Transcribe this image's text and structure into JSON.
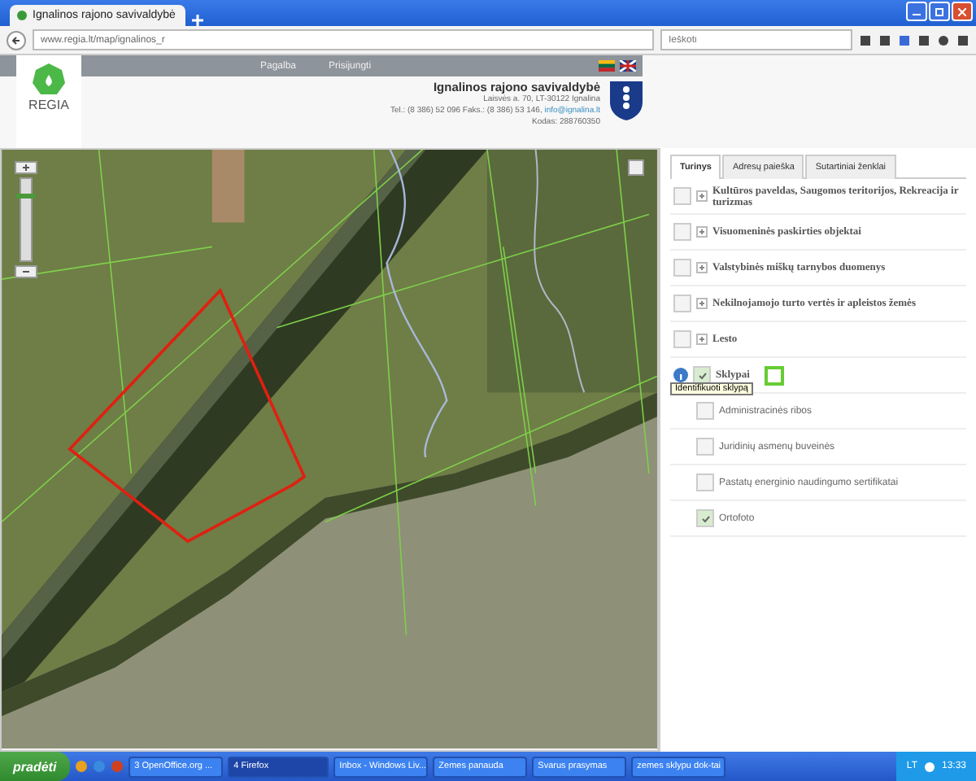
{
  "browser": {
    "tab_title": "Ignalinos rajono savivaldybė",
    "url": "www.regia.lt/map/ignalinos_r",
    "search": {
      "placeholder": "Ieškoti"
    }
  },
  "site": {
    "nav": [
      "Pagalba",
      "Prisijungti"
    ],
    "logo_text": "REGIA",
    "org_title": "Ignalinos rajono savivaldybė",
    "address": "Laisvės a. 70, LT-30122 Ignalina",
    "contacts": "Tel.: (8 386) 52 096 Faks.: (8 386) 53 146,",
    "email": "info@ignalina.lt",
    "code": "Kodas: 288760350"
  },
  "map": {
    "zoom": {
      "level": 0.8
    }
  },
  "panel": {
    "tabs": [
      {
        "label": "Turinys",
        "selected": true
      },
      {
        "label": "Adresų paieška",
        "selected": false
      },
      {
        "label": "Sutartiniai ženklai",
        "selected": false
      }
    ],
    "layers": [
      {
        "kind": "group",
        "label": "Kultūros paveldas, Saugomos teritorijos, Rekreacija ir turizmas",
        "checked": false
      },
      {
        "kind": "group",
        "label": "Visuomeninės paskirties objektai",
        "checked": false
      },
      {
        "kind": "group",
        "label": "Valstybinės miškų tarnybos duomenys",
        "checked": false
      },
      {
        "kind": "group",
        "label": "Nekilnojamojo turto vertės ir apleistos žemės",
        "checked": false
      },
      {
        "kind": "group",
        "label": "Lesto",
        "checked": false
      },
      {
        "kind": "active",
        "label": "Sklypai",
        "checked": true,
        "color": "#66cc33",
        "tooltip": "Identifikuoti sklypą"
      },
      {
        "kind": "layer",
        "label": "Administracinės ribos",
        "checked": false
      },
      {
        "kind": "layer",
        "label": "Juridinių asmenų buveinės",
        "checked": false
      },
      {
        "kind": "layer",
        "label": "Pastatų energinio naudingumo sertifikatai",
        "checked": false
      },
      {
        "kind": "layer",
        "label": "Ortofoto",
        "checked": true
      }
    ]
  },
  "taskbar": {
    "start": "pradėti",
    "tasks": [
      {
        "label": "3 OpenOffice.org ...",
        "selected": false
      },
      {
        "label": "4 Firefox",
        "selected": true
      },
      {
        "label": "Inbox - Windows Liv...",
        "selected": false
      },
      {
        "label": "Zemes panauda",
        "selected": false
      },
      {
        "label": "Svarus prasymas",
        "selected": false
      },
      {
        "label": "zemes sklypu dok-tai",
        "selected": false
      }
    ],
    "language": "LT",
    "clock": "13:33"
  }
}
